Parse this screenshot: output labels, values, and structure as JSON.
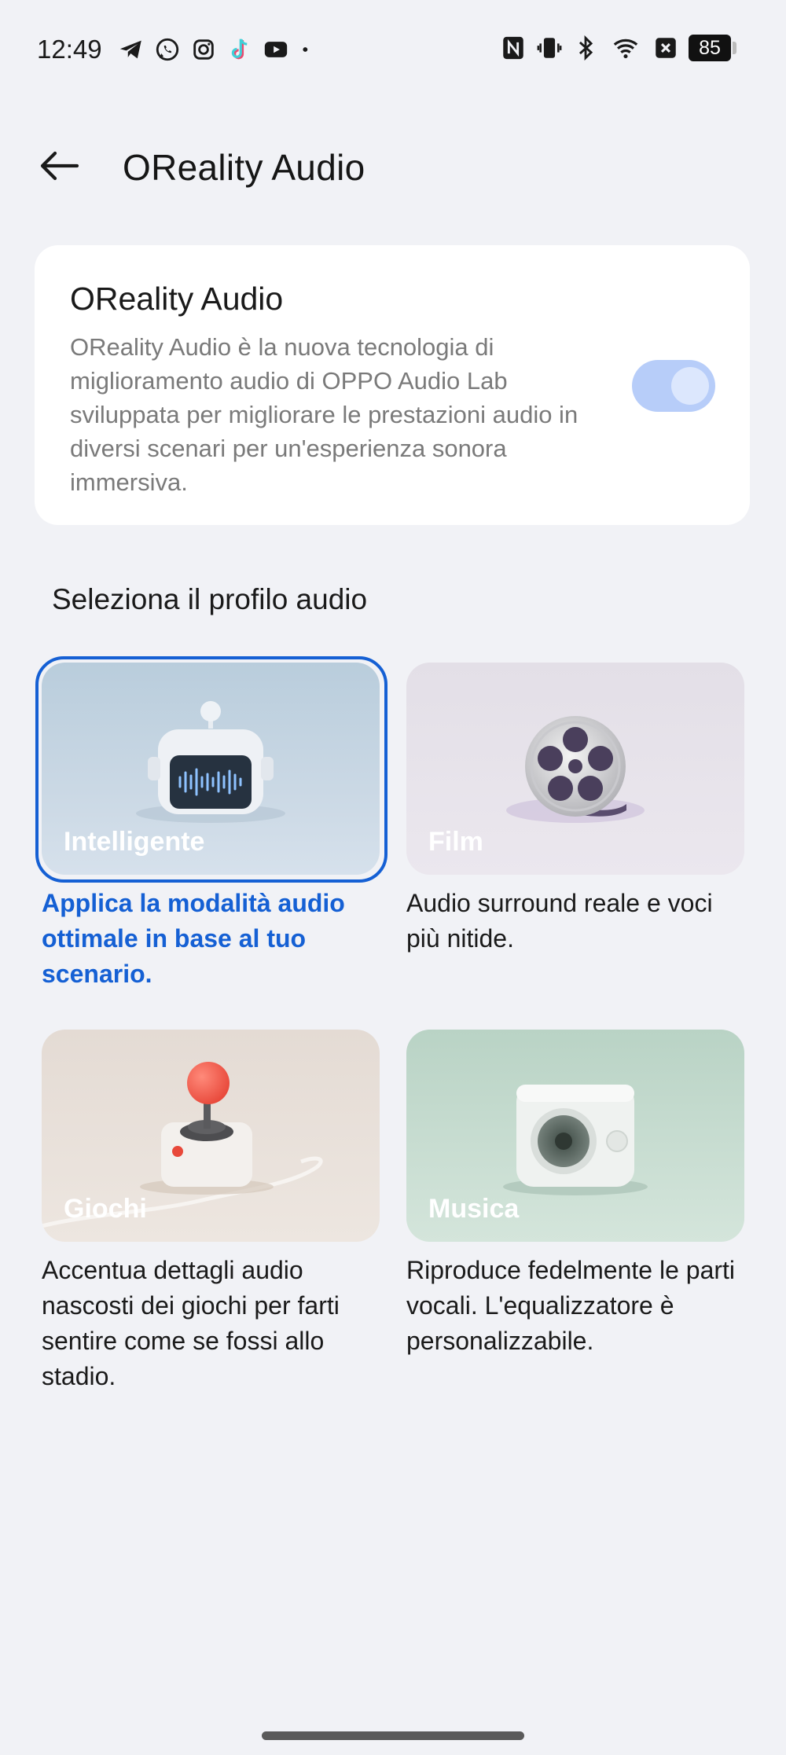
{
  "status_bar": {
    "time": "12:49",
    "notification_icons": [
      "telegram-icon",
      "whatsapp-icon",
      "instagram-icon",
      "tiktok-icon",
      "youtube-icon",
      "more-dot-icon"
    ],
    "system_icons": [
      "nfc-icon",
      "vibrate-icon",
      "bluetooth-icon",
      "wifi-icon",
      "data-off-icon"
    ],
    "battery_level": "85"
  },
  "header": {
    "back_icon": "arrow-left-icon",
    "title": "OReality Audio"
  },
  "feature_card": {
    "title": "OReality Audio",
    "description": "OReality Audio è la nuova tecnologia di miglioramento audio di OPPO Audio Lab sviluppata per migliorare le prestazioni audio in diversi scenari per un'esperienza sonora immersiva.",
    "toggle_on": true,
    "toggle_color": "#b7cdf9"
  },
  "section": {
    "title": "Seleziona il profilo audio"
  },
  "profiles": [
    {
      "name": "Intelligente",
      "description": "Applica la modalità audio ottimale in base al tuo scenario.",
      "selected": true,
      "icon": "robot-waveform-icon"
    },
    {
      "name": "Film",
      "description": "Audio surround reale e voci più nitide.",
      "selected": false,
      "icon": "film-reel-icon"
    },
    {
      "name": "Giochi",
      "description": "Accentua dettagli audio nascosti dei giochi per farti sentire come se fossi allo stadio.",
      "selected": false,
      "icon": "joystick-icon"
    },
    {
      "name": "Musica",
      "description": "Riproduce fedelmente le parti vocali. L'equalizzatore è personalizzabile.",
      "selected": false,
      "icon": "speaker-icon"
    }
  ],
  "colors": {
    "accent": "#1560d4",
    "background": "#f1f2f6",
    "card": "#ffffff"
  }
}
